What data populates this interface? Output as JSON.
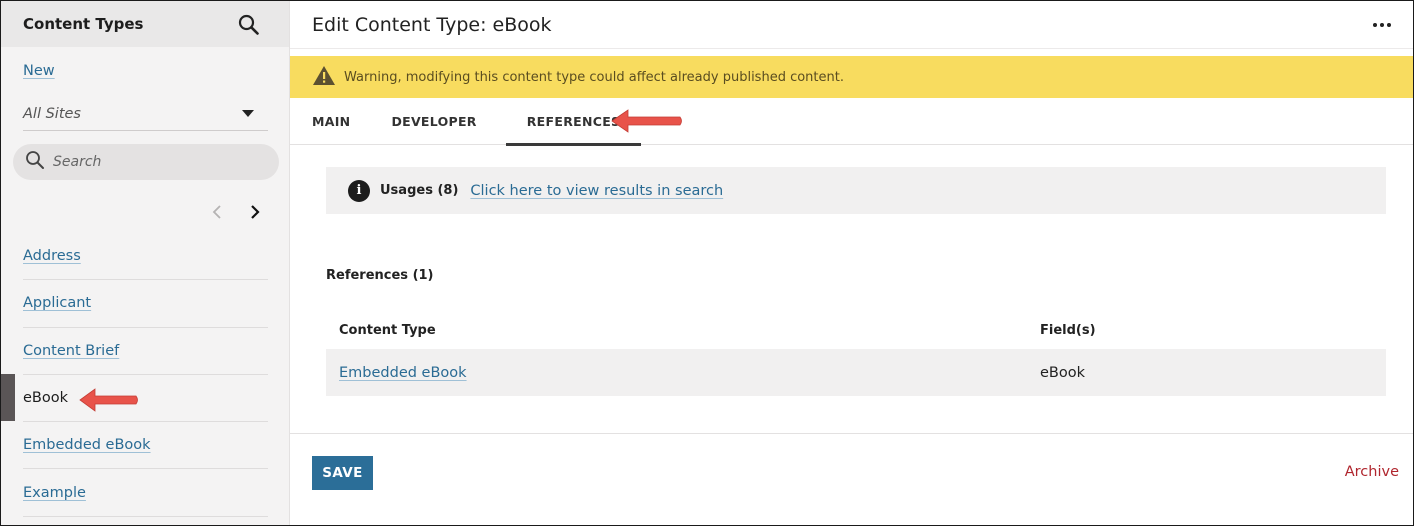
{
  "sidebar": {
    "title": "Content Types",
    "new_label": "New",
    "sites_filter": "All Sites",
    "search_placeholder": "Search",
    "items": [
      {
        "label": "Address"
      },
      {
        "label": "Applicant"
      },
      {
        "label": "Content Brief"
      },
      {
        "label": "eBook",
        "active": true
      },
      {
        "label": "Embedded eBook"
      },
      {
        "label": "Example"
      }
    ]
  },
  "header": {
    "title": "Edit Content Type: eBook"
  },
  "warning": {
    "text": "Warning, modifying this content type could affect already published content."
  },
  "tabs": [
    {
      "label": "MAIN"
    },
    {
      "label": "DEVELOPER"
    },
    {
      "label": "REFERENCES",
      "active": true
    }
  ],
  "usages": {
    "label": "Usages (8)",
    "link": "Click here to view results in search"
  },
  "references": {
    "title": "References (1)",
    "columns": [
      "Content Type",
      "Field(s)"
    ],
    "rows": [
      {
        "content_type": "Embedded eBook",
        "fields": "eBook"
      }
    ]
  },
  "footer": {
    "save_label": "SAVE",
    "archive_label": "Archive"
  },
  "colors": {
    "link": "#2a6b94",
    "warning_bg": "#f8dc5f",
    "primary_button": "#2b6e98",
    "archive": "#b0262e",
    "annotation_arrow": "#e8534a"
  }
}
